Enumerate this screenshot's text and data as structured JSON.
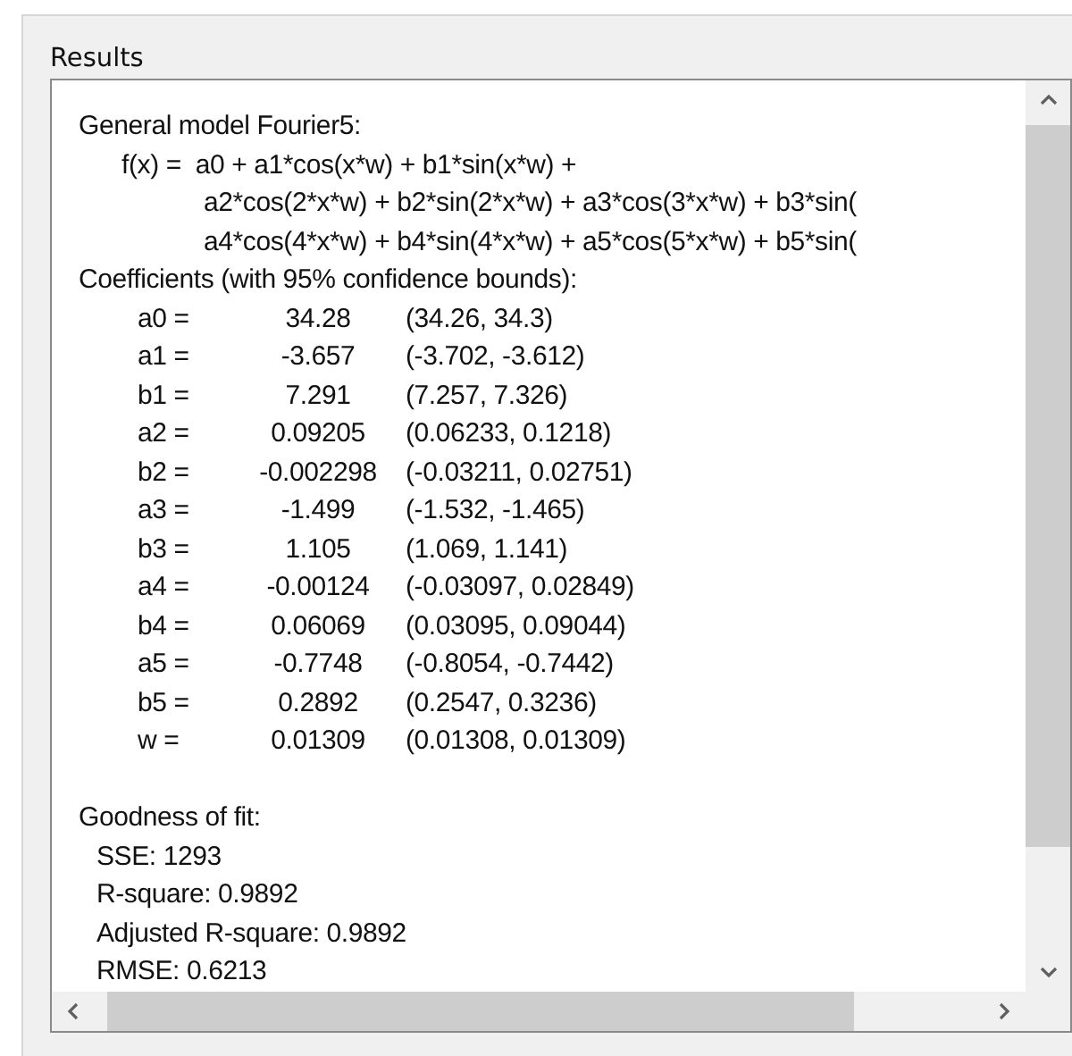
{
  "panel": {
    "title": "Results"
  },
  "model_name": "General model Fourier5:",
  "formula_lines": [
    "f(x) =  a0 + a1*cos(x*w) + b1*sin(x*w) + ",
    "a2*cos(2*x*w) + b2*sin(2*x*w) + a3*cos(3*x*w) + b3*sin(",
    "a4*cos(4*x*w) + b4*sin(4*x*w) + a5*cos(5*x*w) + b5*sin("
  ],
  "coefficients_heading": "Coefficients (with 95% confidence bounds):",
  "coefficients": [
    {
      "name": "a0 =",
      "value": "34.28",
      "bounds": "(34.26, 34.3)"
    },
    {
      "name": "a1 =",
      "value": "-3.657",
      "bounds": "(-3.702, -3.612)"
    },
    {
      "name": "b1 =",
      "value": "7.291",
      "bounds": "(7.257, 7.326)"
    },
    {
      "name": "a2 =",
      "value": "0.09205",
      "bounds": "(0.06233, 0.1218)"
    },
    {
      "name": "b2 =",
      "value": "-0.002298",
      "bounds": "(-0.03211, 0.02751)"
    },
    {
      "name": "a3 =",
      "value": "-1.499",
      "bounds": "(-1.532, -1.465)"
    },
    {
      "name": "b3 =",
      "value": "1.105",
      "bounds": "(1.069, 1.141)"
    },
    {
      "name": "a4 =",
      "value": "-0.00124",
      "bounds": "(-0.03097, 0.02849)"
    },
    {
      "name": "b4 =",
      "value": "0.06069",
      "bounds": "(0.03095, 0.09044)"
    },
    {
      "name": "a5 =",
      "value": "-0.7748",
      "bounds": "(-0.8054, -0.7442)"
    },
    {
      "name": "b5 =",
      "value": "0.2892",
      "bounds": "(0.2547, 0.3236)"
    },
    {
      "name": "w =",
      "value": "0.01309",
      "bounds": "(0.01308, 0.01309)"
    }
  ],
  "goodness_heading": "Goodness of fit:",
  "goodness": [
    "SSE: 1293",
    "R-square: 0.9892",
    "Adjusted R-square: 0.9892",
    "RMSE: 0.6213"
  ]
}
